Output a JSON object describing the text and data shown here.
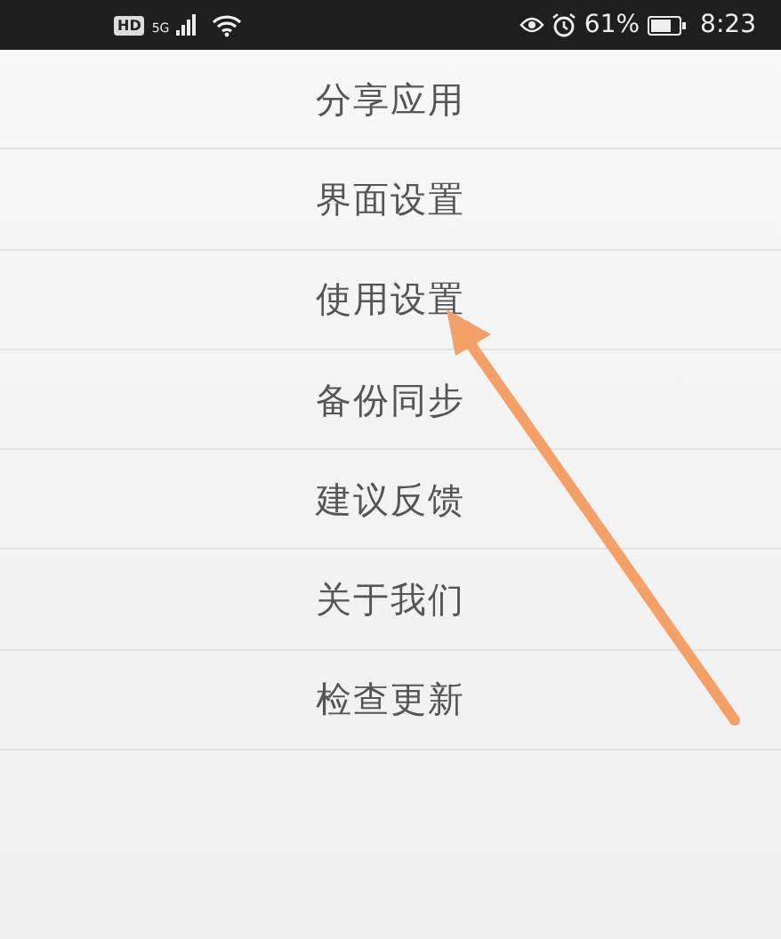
{
  "status_bar": {
    "network_badge": "HD",
    "network_type": "5G",
    "battery_percent": "61%",
    "time": "8:23"
  },
  "menu_items": [
    {
      "label": "分享应用"
    },
    {
      "label": "界面设置"
    },
    {
      "label": "使用设置"
    },
    {
      "label": "备份同步"
    },
    {
      "label": "建议反馈"
    },
    {
      "label": "关于我们"
    },
    {
      "label": "检查更新"
    }
  ]
}
